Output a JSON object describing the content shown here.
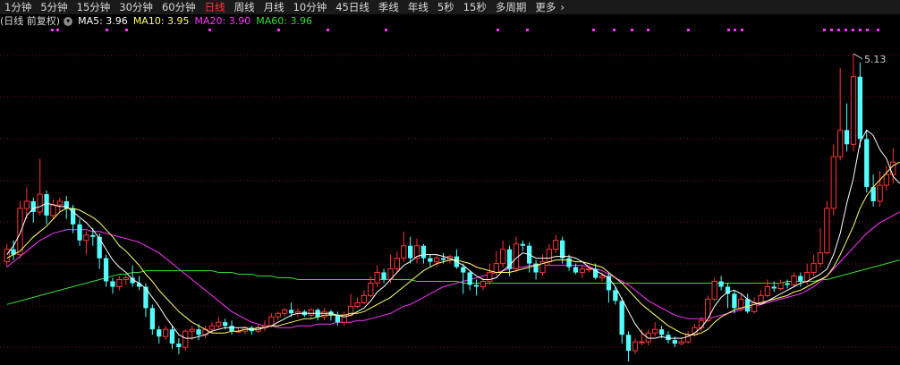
{
  "toolbar": {
    "tabs": [
      "1分钟",
      "5分钟",
      "15分钟",
      "30分钟",
      "60分钟",
      "日线",
      "周线",
      "月线",
      "10分钟",
      "45日线",
      "季线",
      "年线",
      "5秒",
      "15秒",
      "多周期",
      "更多"
    ],
    "active_tab": "日线",
    "more_chevron": "chevron-right-icon"
  },
  "legend": {
    "label": "(日线 前复权)",
    "toggle_icon": "chevron-down-icon",
    "ma5": "MA5: 3.96",
    "ma10": "MA10: 3.95",
    "ma20": "MA20: 3.90",
    "ma60": "MA60: 3.96",
    "colors": {
      "label": "#d8d8d8",
      "ma5": "#ffffff",
      "ma10": "#ffff66",
      "ma20": "#ff33ff",
      "ma60": "#33dd33"
    }
  },
  "chart_data": {
    "type": "candlestick",
    "y_range": [
      3.4,
      5.25
    ],
    "grid": "dotted-horizontal",
    "high_marker": "5.13",
    "colors": {
      "up": "#ff3333",
      "down": "#54ffff",
      "ma5": "#ffffff",
      "ma10": "#ffff66",
      "ma20": "#ff33ff",
      "ma60": "#33dd33",
      "event_dots": "#ff33ff"
    },
    "event_dots": [
      57,
      63,
      118,
      140,
      233,
      310,
      365,
      430,
      555,
      588,
      662,
      685,
      705,
      723,
      768,
      813,
      820,
      828,
      920,
      928,
      936,
      944,
      952,
      960,
      968,
      980
    ],
    "candles": [
      [
        3.96,
        4.03,
        3.93,
        4.06
      ],
      [
        4.03,
        4.0,
        3.97,
        4.08
      ],
      [
        4.0,
        4.26,
        3.98,
        4.3
      ],
      [
        4.26,
        4.3,
        4.2,
        4.38
      ],
      [
        4.3,
        4.24,
        4.18,
        4.32
      ],
      [
        4.24,
        4.34,
        4.22,
        4.54
      ],
      [
        4.34,
        4.22,
        4.17,
        4.36
      ],
      [
        4.22,
        4.28,
        4.2,
        4.31
      ],
      [
        4.28,
        4.3,
        4.24,
        4.32
      ],
      [
        4.3,
        4.26,
        4.2,
        4.33
      ],
      [
        4.26,
        4.17,
        4.12,
        4.28
      ],
      [
        4.17,
        4.08,
        4.05,
        4.2
      ],
      [
        4.08,
        4.11,
        4.0,
        4.13
      ],
      [
        4.11,
        4.1,
        4.05,
        4.15
      ],
      [
        4.1,
        3.98,
        3.92,
        4.12
      ],
      [
        3.98,
        3.85,
        3.82,
        4.0
      ],
      [
        3.85,
        3.82,
        3.78,
        3.87
      ],
      [
        3.82,
        3.86,
        3.8,
        3.88
      ],
      [
        3.86,
        3.87,
        3.83,
        3.89
      ],
      [
        3.87,
        3.84,
        3.82,
        3.94
      ],
      [
        3.84,
        3.82,
        3.8,
        3.88
      ],
      [
        3.82,
        3.7,
        3.65,
        3.84
      ],
      [
        3.7,
        3.58,
        3.55,
        3.72
      ],
      [
        3.58,
        3.54,
        3.5,
        3.6
      ],
      [
        3.54,
        3.58,
        3.52,
        3.6
      ],
      [
        3.58,
        3.5,
        3.47,
        3.6
      ],
      [
        3.5,
        3.48,
        3.44,
        3.53
      ],
      [
        3.48,
        3.57,
        3.46,
        3.58
      ],
      [
        3.57,
        3.58,
        3.52,
        3.6
      ],
      [
        3.58,
        3.55,
        3.52,
        3.61
      ],
      [
        3.55,
        3.58,
        3.53,
        3.6
      ],
      [
        3.58,
        3.6,
        3.56,
        3.62
      ],
      [
        3.6,
        3.62,
        3.58,
        3.65
      ],
      [
        3.62,
        3.6,
        3.58,
        3.64
      ],
      [
        3.6,
        3.57,
        3.55,
        3.63
      ],
      [
        3.57,
        3.57,
        3.56,
        3.59
      ],
      [
        3.57,
        3.59,
        3.55,
        3.6
      ],
      [
        3.59,
        3.57,
        3.55,
        3.6
      ],
      [
        3.57,
        3.59,
        3.56,
        3.61
      ],
      [
        3.59,
        3.6,
        3.57,
        3.63
      ],
      [
        3.6,
        3.65,
        3.59,
        3.67
      ],
      [
        3.65,
        3.67,
        3.63,
        3.68
      ],
      [
        3.67,
        3.69,
        3.65,
        3.7
      ],
      [
        3.69,
        3.67,
        3.65,
        3.73
      ],
      [
        3.67,
        3.68,
        3.65,
        3.7
      ],
      [
        3.68,
        3.66,
        3.65,
        3.69
      ],
      [
        3.66,
        3.69,
        3.64,
        3.7
      ],
      [
        3.69,
        3.65,
        3.63,
        3.7
      ],
      [
        3.65,
        3.68,
        3.63,
        3.7
      ],
      [
        3.68,
        3.66,
        3.63,
        3.69
      ],
      [
        3.66,
        3.62,
        3.6,
        3.68
      ],
      [
        3.62,
        3.66,
        3.6,
        3.68
      ],
      [
        3.66,
        3.71,
        3.65,
        3.78
      ],
      [
        3.71,
        3.73,
        3.7,
        3.76
      ],
      [
        3.73,
        3.77,
        3.72,
        3.8
      ],
      [
        3.77,
        3.84,
        3.76,
        3.88
      ],
      [
        3.84,
        3.9,
        3.82,
        3.94
      ],
      [
        3.9,
        3.86,
        3.84,
        3.92
      ],
      [
        3.86,
        3.92,
        3.84,
        4.0
      ],
      [
        3.92,
        3.98,
        3.9,
        4.02
      ],
      [
        3.98,
        4.05,
        3.96,
        4.13
      ],
      [
        4.05,
        3.98,
        3.95,
        4.1
      ],
      [
        3.98,
        4.05,
        3.95,
        4.09
      ],
      [
        4.05,
        3.98,
        3.95,
        4.06
      ],
      [
        3.98,
        3.96,
        3.93,
        4.0
      ],
      [
        3.96,
        3.98,
        3.93,
        4.0
      ],
      [
        3.98,
        3.97,
        3.95,
        4.01
      ],
      [
        3.97,
        3.99,
        3.95,
        4.0
      ],
      [
        3.99,
        3.93,
        3.92,
        4.03
      ],
      [
        3.93,
        3.9,
        3.78,
        3.95
      ],
      [
        3.9,
        3.83,
        3.8,
        3.91
      ],
      [
        3.83,
        3.82,
        3.77,
        3.86
      ],
      [
        3.82,
        3.85,
        3.8,
        3.87
      ],
      [
        3.85,
        3.9,
        3.83,
        3.95
      ],
      [
        3.9,
        3.95,
        3.88,
        4.02
      ],
      [
        3.95,
        4.03,
        3.93,
        4.08
      ],
      [
        4.03,
        3.92,
        3.88,
        4.05
      ],
      [
        3.92,
        4.06,
        3.9,
        4.1
      ],
      [
        4.06,
        4.05,
        4.02,
        4.08
      ],
      [
        4.05,
        3.95,
        3.9,
        4.07
      ],
      [
        3.95,
        3.9,
        3.86,
        3.97
      ],
      [
        3.9,
        3.96,
        3.88,
        4.0
      ],
      [
        3.96,
        4.03,
        3.94,
        4.06
      ],
      [
        4.03,
        4.08,
        4.01,
        4.11
      ],
      [
        4.08,
        3.98,
        3.95,
        4.1
      ],
      [
        3.98,
        3.93,
        3.91,
        4.0
      ],
      [
        3.93,
        3.9,
        3.89,
        3.95
      ],
      [
        3.9,
        3.92,
        3.87,
        3.94
      ],
      [
        3.92,
        3.92,
        3.9,
        3.94
      ],
      [
        3.92,
        3.87,
        3.86,
        3.95
      ],
      [
        3.87,
        3.88,
        3.85,
        3.9
      ],
      [
        3.88,
        3.8,
        3.73,
        3.9
      ],
      [
        3.8,
        3.74,
        3.72,
        3.82
      ],
      [
        3.74,
        3.55,
        3.5,
        3.76
      ],
      [
        3.55,
        3.46,
        3.4,
        3.57
      ],
      [
        3.46,
        3.51,
        3.44,
        3.53
      ],
      [
        3.51,
        3.51,
        3.49,
        3.58
      ],
      [
        3.51,
        3.56,
        3.49,
        3.58
      ],
      [
        3.56,
        3.58,
        3.54,
        3.62
      ],
      [
        3.58,
        3.55,
        3.53,
        3.6
      ],
      [
        3.55,
        3.52,
        3.5,
        3.57
      ],
      [
        3.52,
        3.5,
        3.48,
        3.54
      ],
      [
        3.5,
        3.51,
        3.49,
        3.53
      ],
      [
        3.51,
        3.55,
        3.5,
        3.57
      ],
      [
        3.55,
        3.59,
        3.54,
        3.61
      ],
      [
        3.59,
        3.63,
        3.57,
        3.65
      ],
      [
        3.63,
        3.75,
        3.62,
        3.77
      ],
      [
        3.75,
        3.85,
        3.74,
        3.87
      ],
      [
        3.85,
        3.82,
        3.8,
        3.88
      ],
      [
        3.82,
        3.78,
        3.7,
        3.84
      ],
      [
        3.78,
        3.7,
        3.67,
        3.8
      ],
      [
        3.7,
        3.75,
        3.68,
        3.78
      ],
      [
        3.75,
        3.68,
        3.67,
        3.78
      ],
      [
        3.68,
        3.73,
        3.67,
        3.76
      ],
      [
        3.73,
        3.77,
        3.72,
        3.8
      ],
      [
        3.77,
        3.82,
        3.76,
        3.86
      ],
      [
        3.82,
        3.81,
        3.79,
        3.85
      ],
      [
        3.81,
        3.84,
        3.8,
        3.86
      ],
      [
        3.84,
        3.83,
        3.81,
        3.86
      ],
      [
        3.83,
        3.88,
        3.82,
        3.9
      ],
      [
        3.88,
        3.85,
        3.82,
        3.9
      ],
      [
        3.85,
        3.9,
        3.83,
        3.95
      ],
      [
        3.9,
        3.95,
        3.88,
        4.0
      ],
      [
        3.95,
        4.01,
        3.93,
        4.15
      ],
      [
        4.01,
        4.26,
        4.0,
        4.3
      ],
      [
        4.26,
        4.55,
        4.22,
        4.62
      ],
      [
        4.55,
        4.7,
        4.53,
        5.05
      ],
      [
        4.7,
        4.62,
        4.58,
        4.85
      ],
      [
        4.62,
        5.0,
        4.58,
        5.13
      ],
      [
        5.0,
        4.65,
        4.6,
        5.08
      ],
      [
        4.65,
        4.38,
        4.35,
        4.7
      ],
      [
        4.38,
        4.3,
        4.27,
        4.45
      ],
      [
        4.3,
        4.39,
        4.27,
        4.47
      ],
      [
        4.39,
        4.45,
        4.36,
        4.5
      ],
      [
        4.45,
        4.52,
        4.4,
        4.6
      ]
    ],
    "ma5": [
      4.0,
      4.05,
      4.12,
      4.22,
      4.26,
      4.27,
      4.29,
      4.28,
      4.27,
      4.27,
      4.24,
      4.21,
      4.18,
      4.14,
      4.09,
      4.03,
      3.97,
      3.93,
      3.9,
      3.86,
      3.84,
      3.81,
      3.76,
      3.71,
      3.65,
      3.6,
      3.55,
      3.53,
      3.53,
      3.54,
      3.55,
      3.57,
      3.58,
      3.59,
      3.59,
      3.59,
      3.59,
      3.58,
      3.58,
      3.59,
      3.6,
      3.62,
      3.64,
      3.66,
      3.67,
      3.67,
      3.67,
      3.67,
      3.67,
      3.67,
      3.66,
      3.65,
      3.66,
      3.68,
      3.7,
      3.74,
      3.79,
      3.82,
      3.86,
      3.9,
      3.94,
      3.96,
      3.99,
      4.0,
      4.0,
      4.0,
      3.99,
      3.98,
      3.96,
      3.94,
      3.91,
      3.88,
      3.86,
      3.86,
      3.87,
      3.91,
      3.94,
      3.98,
      4.01,
      4.0,
      3.98,
      3.98,
      3.98,
      3.99,
      3.99,
      3.99,
      3.98,
      3.96,
      3.93,
      3.91,
      3.89,
      3.87,
      3.82,
      3.75,
      3.68,
      3.61,
      3.56,
      3.53,
      3.53,
      3.54,
      3.53,
      3.53,
      3.53,
      3.54,
      3.56,
      3.59,
      3.64,
      3.71,
      3.76,
      3.79,
      3.8,
      3.78,
      3.75,
      3.73,
      3.72,
      3.74,
      3.76,
      3.78,
      3.8,
      3.82,
      3.84,
      3.85,
      3.87,
      3.89,
      3.92,
      4.0,
      4.12,
      4.29,
      4.43,
      4.63,
      4.7,
      4.67,
      4.59,
      4.54,
      4.44,
      4.4
    ],
    "ma10": [
      3.98,
      4.0,
      4.02,
      4.06,
      4.1,
      4.13,
      4.16,
      4.2,
      4.24,
      4.26,
      4.26,
      4.25,
      4.23,
      4.21,
      4.18,
      4.14,
      4.1,
      4.05,
      4.02,
      3.98,
      3.94,
      3.89,
      3.85,
      3.8,
      3.76,
      3.72,
      3.68,
      3.65,
      3.62,
      3.6,
      3.58,
      3.56,
      3.56,
      3.56,
      3.57,
      3.57,
      3.58,
      3.58,
      3.59,
      3.59,
      3.6,
      3.6,
      3.61,
      3.62,
      3.63,
      3.64,
      3.64,
      3.65,
      3.66,
      3.66,
      3.66,
      3.66,
      3.67,
      3.67,
      3.68,
      3.7,
      3.72,
      3.74,
      3.76,
      3.79,
      3.82,
      3.85,
      3.88,
      3.91,
      3.93,
      3.95,
      3.96,
      3.97,
      3.97,
      3.96,
      3.95,
      3.93,
      3.92,
      3.91,
      3.9,
      3.9,
      3.9,
      3.91,
      3.92,
      3.93,
      3.94,
      3.95,
      3.96,
      3.97,
      3.97,
      3.97,
      3.96,
      3.96,
      3.95,
      3.94,
      3.93,
      3.9,
      3.87,
      3.84,
      3.8,
      3.76,
      3.72,
      3.69,
      3.66,
      3.63,
      3.6,
      3.58,
      3.56,
      3.55,
      3.55,
      3.56,
      3.58,
      3.62,
      3.65,
      3.67,
      3.69,
      3.7,
      3.71,
      3.72,
      3.73,
      3.74,
      3.75,
      3.76,
      3.77,
      3.79,
      3.8,
      3.82,
      3.84,
      3.86,
      3.88,
      3.93,
      4.0,
      4.08,
      4.16,
      4.26,
      4.33,
      4.38,
      4.42,
      4.46,
      4.5,
      4.52
    ],
    "ma20": [
      3.93,
      3.96,
      3.99,
      4.02,
      4.05,
      4.08,
      4.1,
      4.12,
      4.13,
      4.14,
      4.14,
      4.14,
      4.14,
      4.13,
      4.13,
      4.12,
      4.11,
      4.1,
      4.09,
      4.08,
      4.07,
      4.05,
      4.03,
      4.01,
      3.98,
      3.95,
      3.92,
      3.89,
      3.86,
      3.83,
      3.8,
      3.77,
      3.74,
      3.71,
      3.68,
      3.66,
      3.64,
      3.62,
      3.61,
      3.6,
      3.6,
      3.59,
      3.59,
      3.59,
      3.6,
      3.6,
      3.6,
      3.61,
      3.61,
      3.61,
      3.62,
      3.62,
      3.62,
      3.63,
      3.63,
      3.64,
      3.65,
      3.66,
      3.67,
      3.69,
      3.71,
      3.72,
      3.74,
      3.76,
      3.78,
      3.8,
      3.82,
      3.83,
      3.84,
      3.85,
      3.86,
      3.87,
      3.88,
      3.89,
      3.9,
      3.91,
      3.92,
      3.93,
      3.93,
      3.94,
      3.94,
      3.94,
      3.94,
      3.94,
      3.94,
      3.94,
      3.94,
      3.94,
      3.93,
      3.92,
      3.91,
      3.89,
      3.87,
      3.85,
      3.83,
      3.8,
      3.77,
      3.74,
      3.72,
      3.7,
      3.68,
      3.66,
      3.65,
      3.64,
      3.64,
      3.64,
      3.64,
      3.65,
      3.66,
      3.67,
      3.68,
      3.69,
      3.7,
      3.71,
      3.72,
      3.73,
      3.74,
      3.75,
      3.76,
      3.77,
      3.78,
      3.8,
      3.82,
      3.85,
      3.88,
      3.92,
      3.96,
      4.0,
      4.04,
      4.08,
      4.12,
      4.15,
      4.18,
      4.2,
      4.22,
      4.24
    ],
    "ma60": [
      3.72,
      3.73,
      3.74,
      3.75,
      3.76,
      3.77,
      3.78,
      3.79,
      3.8,
      3.81,
      3.82,
      3.83,
      3.84,
      3.85,
      3.86,
      3.87,
      3.88,
      3.89,
      3.89,
      3.9,
      3.9,
      3.91,
      3.91,
      3.91,
      3.91,
      3.91,
      3.91,
      3.91,
      3.91,
      3.91,
      3.91,
      3.91,
      3.9,
      3.9,
      3.9,
      3.89,
      3.89,
      3.89,
      3.88,
      3.88,
      3.88,
      3.87,
      3.87,
      3.87,
      3.86,
      3.86,
      3.86,
      3.86,
      3.86,
      3.86,
      3.86,
      3.86,
      3.86,
      3.86,
      3.86,
      3.86,
      3.86,
      3.86,
      3.86,
      3.86,
      3.86,
      3.86,
      3.85,
      3.85,
      3.85,
      3.85,
      3.85,
      3.85,
      3.85,
      3.84,
      3.84,
      3.84,
      3.84,
      3.84,
      3.84,
      3.84,
      3.84,
      3.84,
      3.84,
      3.84,
      3.84,
      3.84,
      3.84,
      3.84,
      3.84,
      3.84,
      3.84,
      3.84,
      3.84,
      3.84,
      3.84,
      3.84,
      3.84,
      3.84,
      3.84,
      3.84,
      3.84,
      3.84,
      3.84,
      3.84,
      3.84,
      3.84,
      3.84,
      3.84,
      3.84,
      3.84,
      3.84,
      3.84,
      3.84,
      3.84,
      3.84,
      3.84,
      3.84,
      3.84,
      3.84,
      3.84,
      3.84,
      3.84,
      3.85,
      3.85,
      3.85,
      3.85,
      3.85,
      3.86,
      3.86,
      3.87,
      3.88,
      3.89,
      3.9,
      3.91,
      3.92,
      3.93,
      3.94,
      3.95,
      3.96,
      3.97
    ]
  }
}
